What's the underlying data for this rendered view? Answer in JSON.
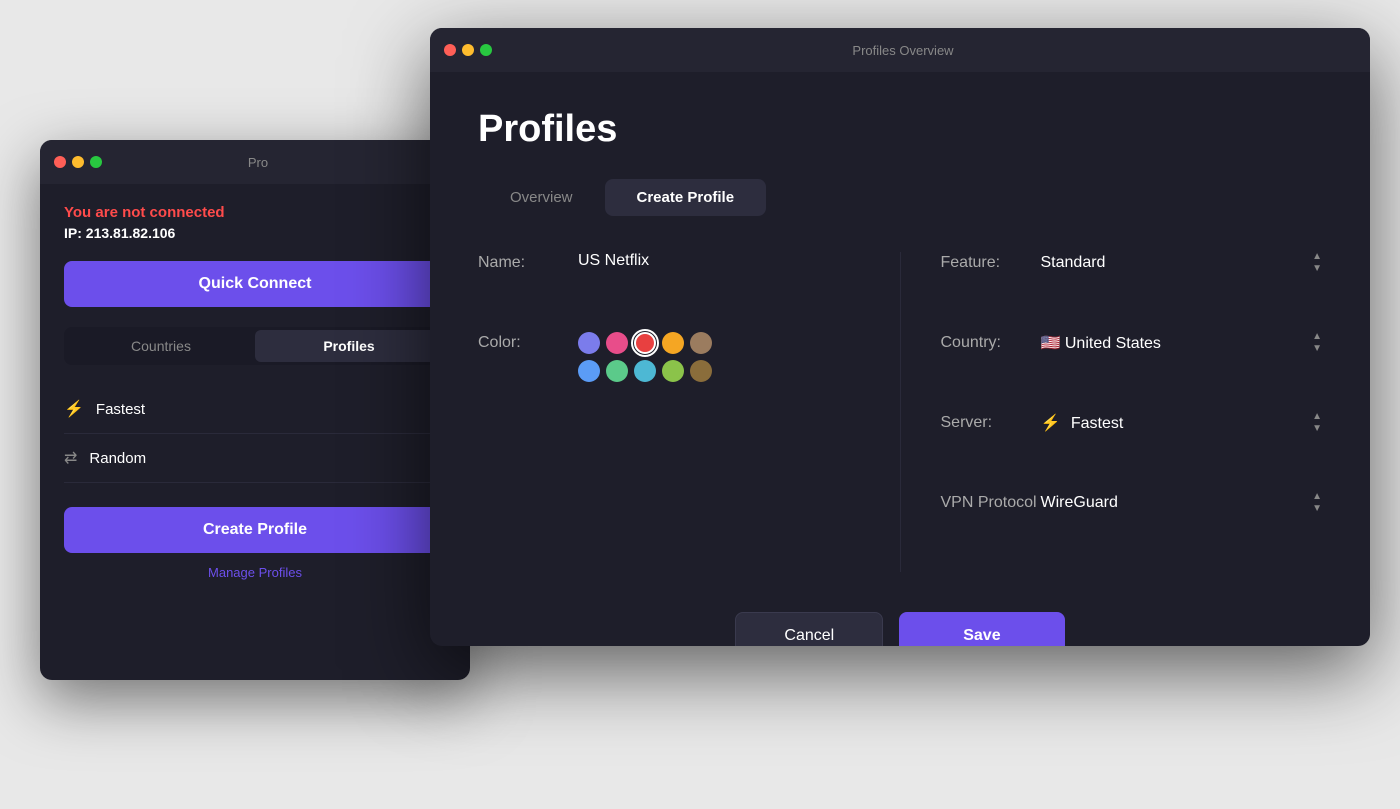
{
  "bg_window": {
    "title": "Pro",
    "connection_status": "You are not connected",
    "ip_label": "IP:",
    "ip_value": "213.81.82.106",
    "quick_connect_label": "Quick Connect",
    "tab_countries": "Countries",
    "tab_profiles": "Profiles",
    "active_tab": "Profiles",
    "profile_items": [
      {
        "icon": "⚡",
        "label": "Fastest"
      },
      {
        "icon": "⇄",
        "label": "Random"
      }
    ],
    "create_profile_label": "Create Profile",
    "manage_profiles_label": "Manage Profiles"
  },
  "fg_window": {
    "title": "Profiles Overview",
    "page_title": "Profiles",
    "tab_overview": "Overview",
    "tab_create": "Create Profile",
    "active_tab": "Create Profile",
    "form": {
      "name_label": "Name:",
      "name_value": "US Netflix",
      "color_label": "Color:",
      "colors": [
        {
          "hex": "#7b7ceb",
          "selected": false
        },
        {
          "hex": "#e84d8a",
          "selected": false
        },
        {
          "hex": "#e84040",
          "selected": true
        },
        {
          "hex": "#f5a623",
          "selected": false
        },
        {
          "hex": "#9b7c5f",
          "selected": false
        },
        {
          "hex": "#5b9cf6",
          "selected": false
        },
        {
          "hex": "#5bca8a",
          "selected": false
        },
        {
          "hex": "#4db8d4",
          "selected": false
        },
        {
          "hex": "#8bc34a",
          "selected": false
        },
        {
          "hex": "#8a6d3b",
          "selected": false
        }
      ],
      "feature_label": "Feature:",
      "feature_value": "Standard",
      "country_label": "Country:",
      "country_flag": "🇺🇸",
      "country_value": "United States",
      "server_label": "Server:",
      "server_icon": "⚡",
      "server_value": "Fastest",
      "vpn_protocol_label": "VPN Protocol",
      "vpn_protocol_value": "WireGuard",
      "cancel_label": "Cancel",
      "save_label": "Save"
    }
  }
}
